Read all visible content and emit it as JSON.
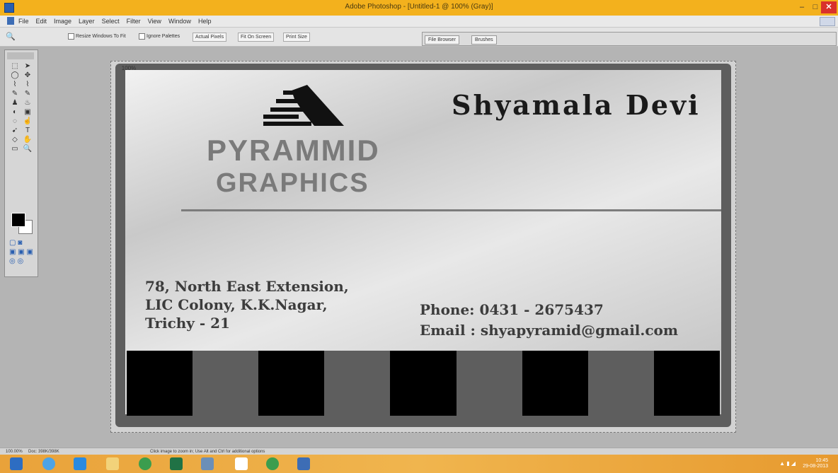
{
  "window": {
    "title": "Adobe Photoshop - [Untitled-1 @ 100% (Gray)]",
    "controls": {
      "minimize": "–",
      "maximize": "□",
      "close": "✕"
    }
  },
  "menubar": {
    "items": [
      "File",
      "Edit",
      "Image",
      "Layer",
      "Select",
      "Filter",
      "View",
      "Window",
      "Help"
    ]
  },
  "options": {
    "zoom_tool": "🔍",
    "resize_windows": "Resize Windows To Fit",
    "ignore_palettes": "Ignore Palettes",
    "actual_pixels": "Actual Pixels",
    "fit_on_screen": "Fit On Screen",
    "print_size": "Print Size"
  },
  "palette_well": {
    "tabs": [
      "File Browser",
      "Brushes"
    ]
  },
  "toolbox": {
    "tools": [
      "⬚",
      "➤",
      "◯",
      "✥",
      "⌇",
      "⌇",
      "✎",
      "✎",
      "♟",
      "♨",
      "◐",
      "▣",
      "◌",
      "☝",
      "➹",
      "T",
      "◇",
      "✋",
      "▭",
      "🔍"
    ],
    "mode_icons": "▢ ◙\n▣ ▣ ▣\n◎ ◎"
  },
  "canvas": {
    "corner_label": "100%",
    "card": {
      "logo_line1": "PYRAMMID",
      "logo_line2": "GRAPHICS",
      "name": "Shyamala Devi",
      "address": [
        "78, North East Extension,",
        "LIC Colony, K.K.Nagar,",
        "Trichy - 21"
      ],
      "phone": "Phone: 0431 - 2675437",
      "email": "Email : shyapyramid@gmail.com"
    }
  },
  "statusbar": {
    "zoom": "100.00%",
    "doc": "Doc: 398K/398K",
    "message": "Click image to zoom in; Use Alt and Ctrl for additional options"
  },
  "taskbar": {
    "time": "10:45",
    "date": "29-08-2013"
  },
  "colors": {
    "titlebar": "#f3b11d",
    "taskbar": "#f0b54e",
    "canvas_border": "#5e5e5e",
    "logo_grey": "#7a7a7a"
  }
}
